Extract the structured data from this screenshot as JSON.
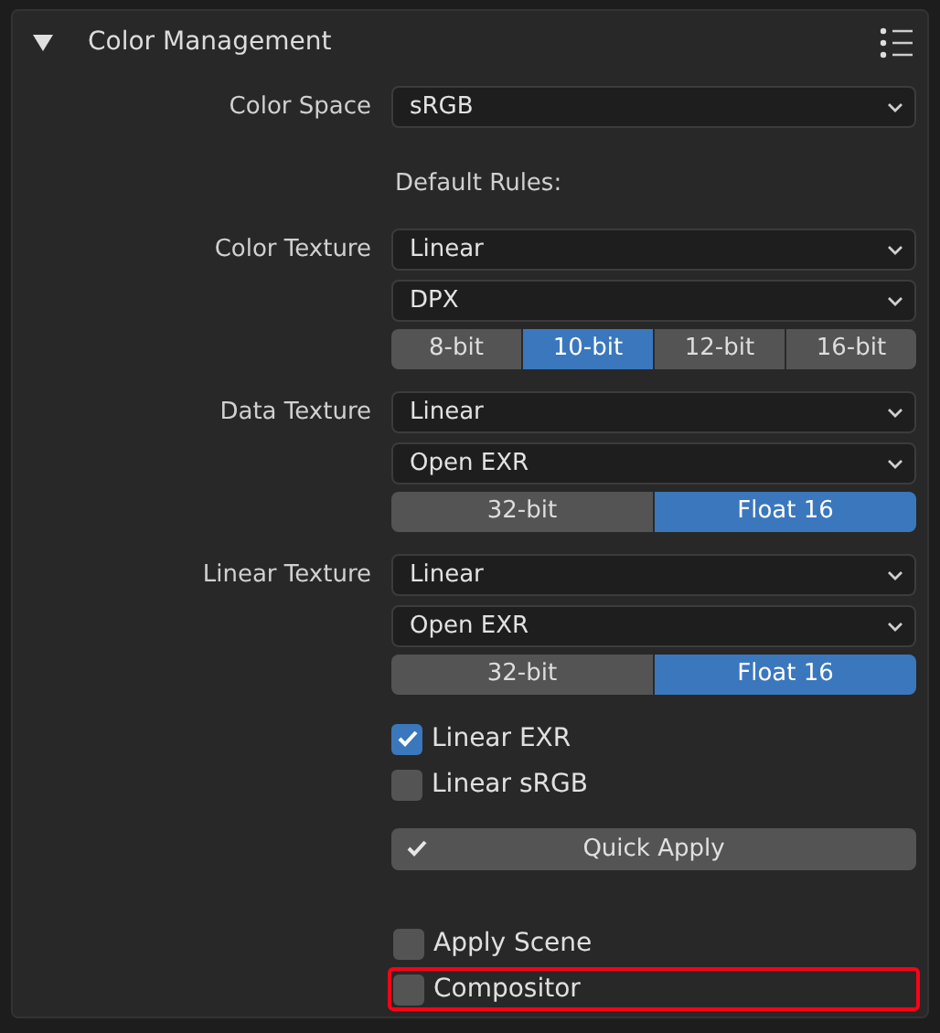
{
  "panel": {
    "title": "Color Management",
    "expanded": true
  },
  "color_space": {
    "label": "Color Space",
    "value": "sRGB"
  },
  "default_rules_label": "Default Rules:",
  "rules": [
    {
      "label": "Color Texture",
      "color_space": "Linear",
      "format": "DPX",
      "depths": [
        {
          "label": "8-bit",
          "selected": false
        },
        {
          "label": "10-bit",
          "selected": true
        },
        {
          "label": "12-bit",
          "selected": false
        },
        {
          "label": "16-bit",
          "selected": false
        }
      ]
    },
    {
      "label": "Data Texture",
      "color_space": "Linear",
      "format": "Open EXR",
      "depths": [
        {
          "label": "32-bit",
          "selected": false
        },
        {
          "label": "Float 16",
          "selected": true
        }
      ]
    },
    {
      "label": "Linear Texture",
      "color_space": "Linear",
      "format": "Open EXR",
      "depths": [
        {
          "label": "32-bit",
          "selected": false
        },
        {
          "label": "Float 16",
          "selected": true
        }
      ]
    }
  ],
  "options": [
    {
      "label": "Linear EXR",
      "checked": true
    },
    {
      "label": "Linear sRGB",
      "checked": false
    }
  ],
  "quick_apply": {
    "label": "Quick Apply"
  },
  "apply_options": [
    {
      "label": "Apply Scene",
      "checked": false,
      "highlighted": false
    },
    {
      "label": "Compositor",
      "checked": false,
      "highlighted": true
    }
  ]
}
